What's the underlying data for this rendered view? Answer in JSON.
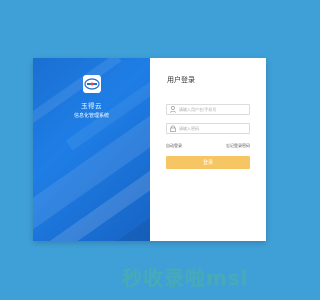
{
  "brand": {
    "name": "玉得云",
    "subtitle": "信息化管理系统",
    "logo_icon": "company-logo-icon"
  },
  "login": {
    "title": "用户登录",
    "username_placeholder": "请输入用户名/手机号",
    "password_placeholder": "请输入密码",
    "remember_label": "自动登录",
    "forgot_label": "忘记登录密码",
    "submit_label": "登录"
  },
  "watermark": {
    "text": "秒收录啦msl"
  },
  "colors": {
    "page_background": "#3fa0d8",
    "brand_panel": "#1e7ee6",
    "button": "#f6c664"
  }
}
